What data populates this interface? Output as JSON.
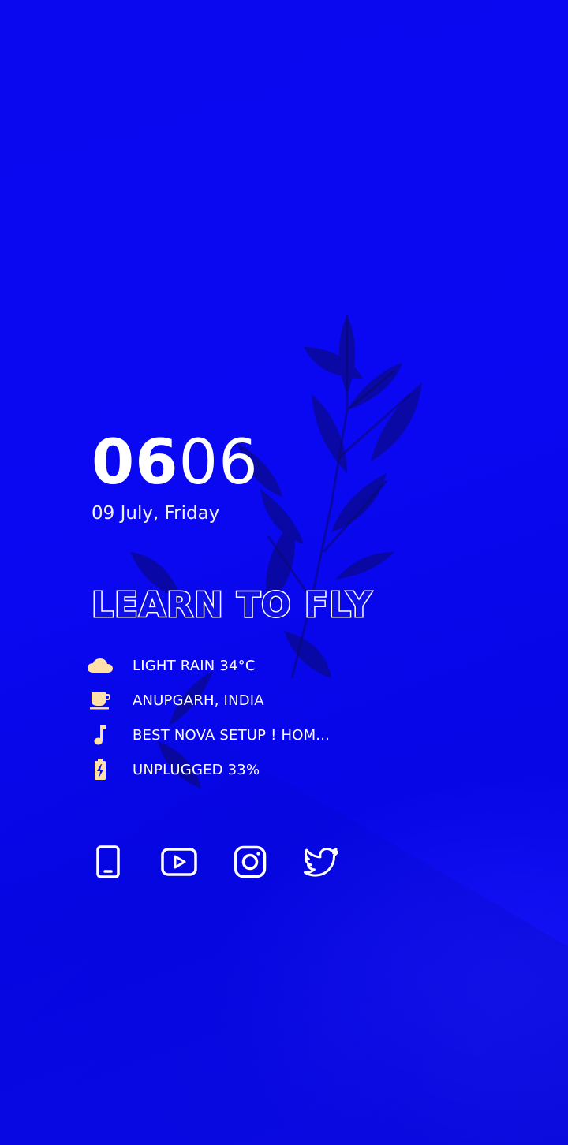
{
  "clock": {
    "hours": "06",
    "minutes": "06"
  },
  "date": "09 July, Friday",
  "headline": "LEARN TO FLY",
  "info": [
    {
      "icon": "cloud-icon",
      "text": "LIGHT RAIN 34°C"
    },
    {
      "icon": "coffee-cup-icon",
      "text": "ANUPGARH, INDIA"
    },
    {
      "icon": "music-note-icon",
      "text": "BEST NOVA SETUP ! HOM..."
    },
    {
      "icon": "battery-charging-icon",
      "text": "UNPLUGGED 33%"
    }
  ],
  "dock": [
    {
      "icon": "phone-icon"
    },
    {
      "icon": "youtube-icon"
    },
    {
      "icon": "instagram-icon"
    },
    {
      "icon": "twitter-icon"
    }
  ],
  "colors": {
    "background": "#0a0af0",
    "text": "#ffffff",
    "accent_icons": "#ffe0a8"
  }
}
